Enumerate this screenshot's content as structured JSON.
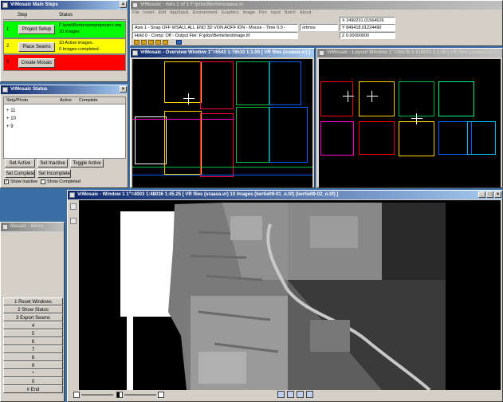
{
  "main_steps": {
    "title": "VrMosaic Main Steps",
    "col_step": "Step",
    "col_status": "Status",
    "rows": [
      {
        "num": "1",
        "button": "Project Setup",
        "status1": "F:\\jobs\\Bertie\\sampleproject.osp",
        "status2": "10 Images",
        "color": "#00ff00"
      },
      {
        "num": "2",
        "button": "Place Seams",
        "status1": "10 Active images.",
        "status2": "0 Images completed.",
        "color": "#ffff00"
      },
      {
        "num": "3",
        "button": "Create Mosaic",
        "status1": "",
        "status2": "",
        "color": "#ff0000"
      }
    ]
  },
  "aws": {
    "title": "VrMosaic - Aws 1 of 1 F:\\jobs\\Bertie\\sraaoa.vr",
    "menu": [
      "File",
      "Insert",
      "Edit",
      "AppStack",
      "Environment",
      "Graphics",
      "Image",
      "Pen",
      "Input",
      "Batch",
      "About"
    ],
    "status_line1": "Aws 1 - Snap OFF WSALL ALL END 3D VON AOFF ION - Mouse - Time 0.0 -",
    "status_line2": "Hold 0 - Comp: Off - Output File: F:\\jobs\\Bertie\\testimage.tif",
    "units": "ortmos",
    "x": "X 2490231.01564626",
    "y": "Y 849418.01224490",
    "z": "Z 0.00000000"
  },
  "overview": {
    "title": "VrMosaic - Overview Window  1\"=6543  1:78510  1:1.00  [ VR files (sraaoa.vr) ]"
  },
  "layout": {
    "title": "VrMosaic - Layout Window  1\"=26578  1:318933  1:1.00  [ VR files (sraaoa.vr) ]"
  },
  "status_win": {
    "title": "VrMosaic Status",
    "col_strip": "Strip/Photo",
    "col_active": "Active",
    "col_complete": "Complete",
    "items": [
      {
        "expander": "+",
        "label": "11"
      },
      {
        "expander": "+",
        "label": "10"
      },
      {
        "expander": "+",
        "label": "9"
      }
    ],
    "buttons": [
      "Set Active",
      "Set Inactive",
      "Toggle Active",
      "Set Complete",
      "Set Incomplete"
    ],
    "show_inactive": "Show Inactive",
    "show_completed": "Show Completed"
  },
  "window1": {
    "title": "VrMosaic - Window 1  1\"=4003  1:48036  1:45.25  [ VR files (sraaoa.vr) 10 Images (bertie09-01_o.tif) (bertie09-02_o.tif) ]"
  },
  "menu_win": {
    "title": "Mosaic - Menu",
    "items": [
      "1 Reset Windows",
      "2 Show Status",
      "3 Export Seams",
      "4",
      "5",
      "6",
      "7",
      "8",
      "9",
      "*",
      "0",
      "# End"
    ]
  }
}
